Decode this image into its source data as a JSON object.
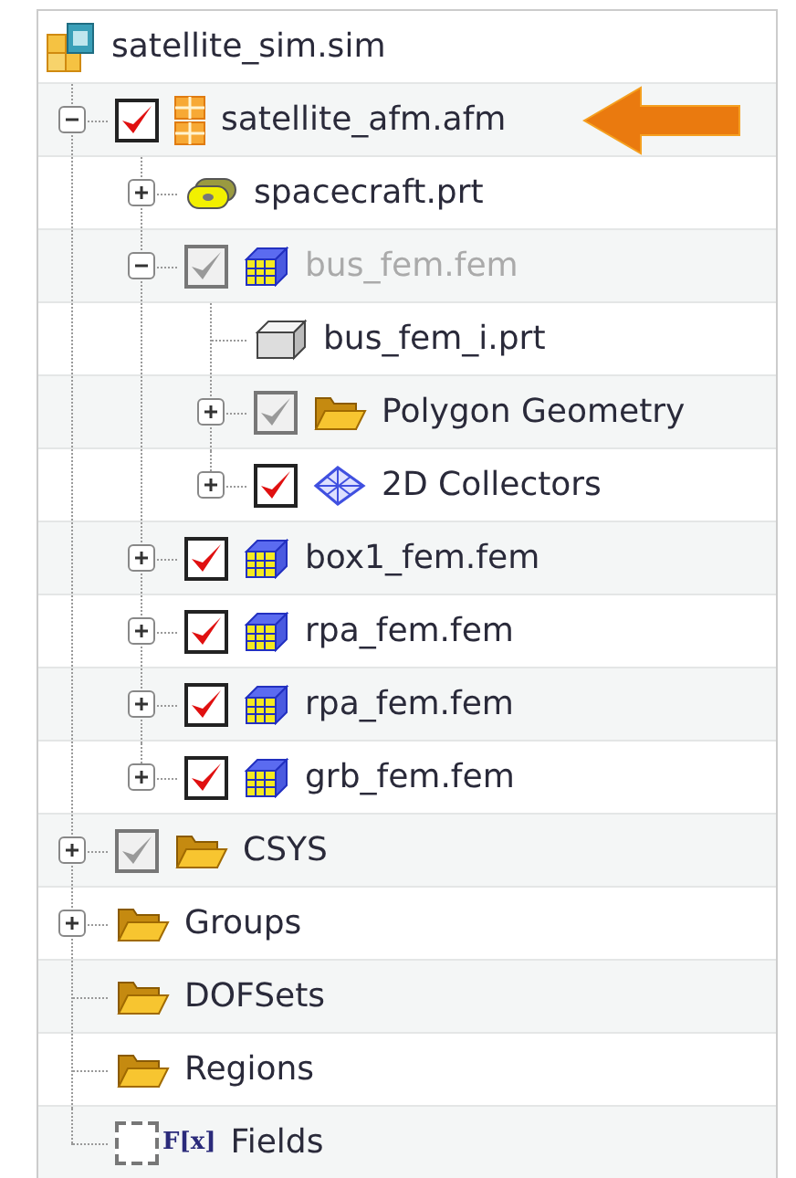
{
  "tree": {
    "label": "satellite_sim.sim",
    "kind": "sim",
    "children": [
      {
        "label": "satellite_afm.afm",
        "kind": "assembly",
        "checkbox": {
          "checked": true,
          "dimmed": false
        },
        "expanded": true,
        "disabled": false,
        "pointed": true,
        "children": [
          {
            "label": "spacecraft.prt",
            "kind": "part",
            "expanded": false,
            "disabled": false,
            "pointed": false
          },
          {
            "label": "bus_fem.fem",
            "kind": "fem",
            "checkbox": {
              "checked": true,
              "dimmed": true
            },
            "expanded": true,
            "disabled": true,
            "pointed": false,
            "children": [
              {
                "label": "bus_fem_i.prt",
                "kind": "body",
                "disabled": false,
                "pointed": false
              },
              {
                "label": "Polygon Geometry",
                "kind": "folder",
                "checkbox": {
                  "checked": true,
                  "dimmed": true
                },
                "expanded": false,
                "disabled": false,
                "pointed": false
              },
              {
                "label": "2D Collectors",
                "kind": "collector",
                "checkbox": {
                  "checked": true,
                  "dimmed": false
                },
                "expanded": false,
                "disabled": false,
                "pointed": false
              }
            ]
          },
          {
            "label": "box1_fem.fem",
            "kind": "fem",
            "checkbox": {
              "checked": true,
              "dimmed": false
            },
            "expanded": false,
            "disabled": false,
            "pointed": false
          },
          {
            "label": "rpa_fem.fem",
            "kind": "fem",
            "checkbox": {
              "checked": true,
              "dimmed": false
            },
            "expanded": false,
            "disabled": false,
            "pointed": false
          },
          {
            "label": "rpa_fem.fem",
            "kind": "fem",
            "checkbox": {
              "checked": true,
              "dimmed": false
            },
            "expanded": false,
            "disabled": false,
            "pointed": false
          },
          {
            "label": "grb_fem.fem",
            "kind": "fem",
            "checkbox": {
              "checked": true,
              "dimmed": false
            },
            "expanded": false,
            "disabled": false,
            "pointed": false
          }
        ]
      },
      {
        "label": "CSYS",
        "kind": "folder",
        "checkbox": {
          "checked": true,
          "dimmed": true
        },
        "expanded": false,
        "disabled": false,
        "pointed": false
      },
      {
        "label": "Groups",
        "kind": "folder",
        "expanded": false,
        "disabled": false,
        "pointed": false
      },
      {
        "label": "DOFSets",
        "kind": "folder",
        "disabled": false,
        "pointed": false
      },
      {
        "label": "Regions",
        "kind": "folder",
        "disabled": false,
        "pointed": false
      },
      {
        "label": "Fields",
        "kind": "field",
        "checkbox": {
          "checked": false,
          "dimmed": false
        },
        "symbol": "F[x]",
        "disabled": false,
        "pointed": false
      }
    ]
  }
}
